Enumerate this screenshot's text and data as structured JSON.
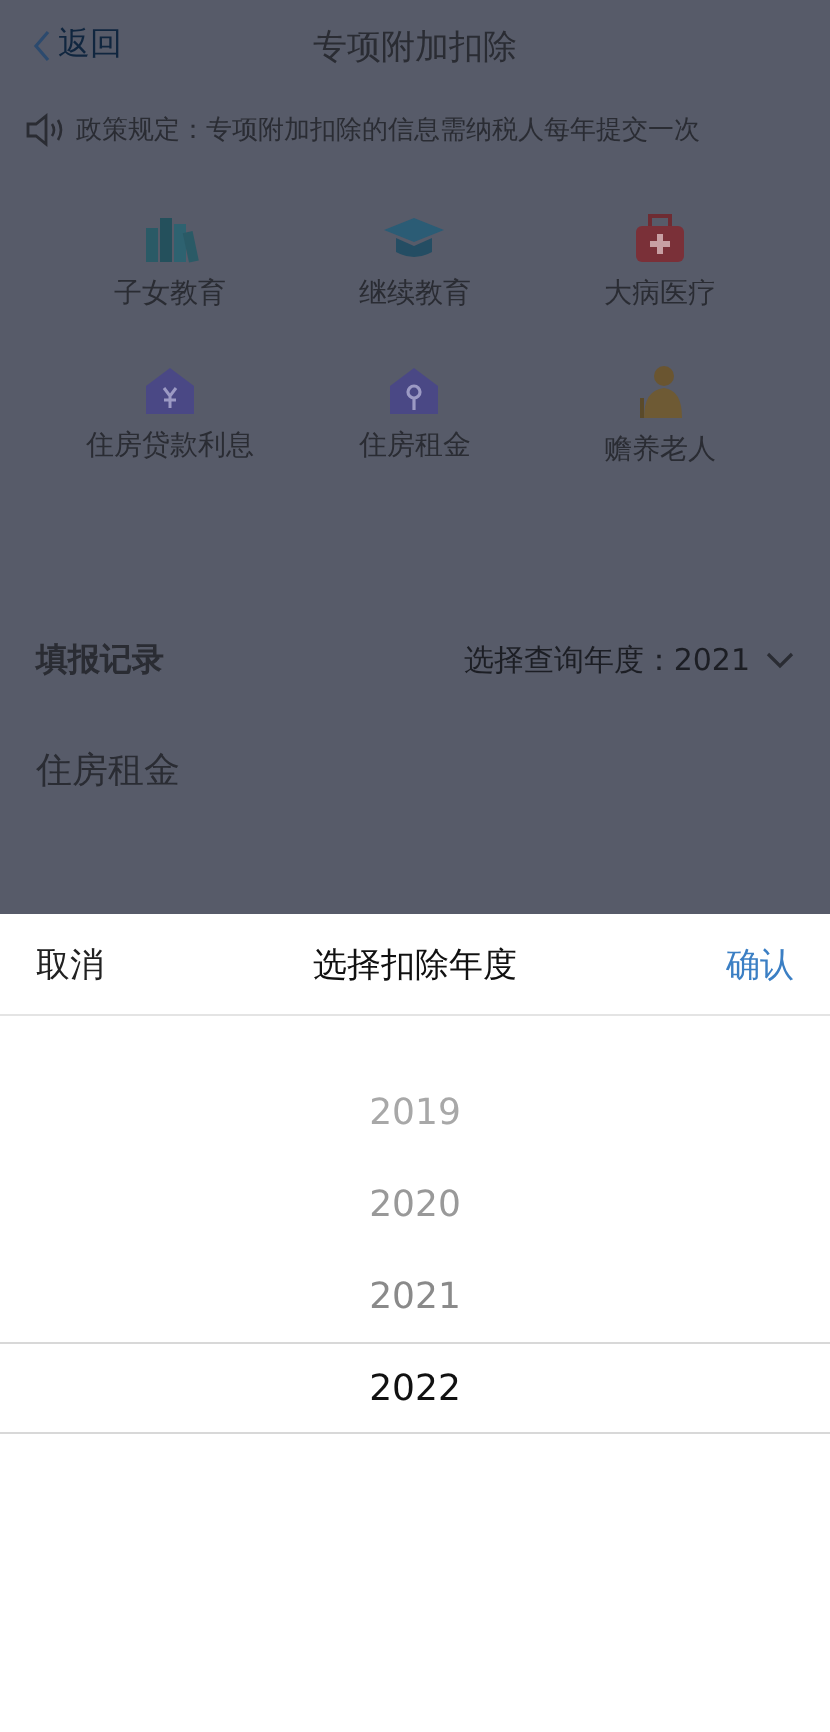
{
  "nav": {
    "back": "返回",
    "title": "专项附加扣除"
  },
  "notice": "政策规定：专项附加扣除的信息需纳税人每年提交一次",
  "categories": [
    {
      "kind": "books",
      "label": "子女教育"
    },
    {
      "kind": "cap",
      "label": "继续教育"
    },
    {
      "kind": "medkit",
      "label": "大病医疗"
    },
    {
      "kind": "house-yen",
      "label": "住房贷款利息"
    },
    {
      "kind": "house-key",
      "label": "住房租金"
    },
    {
      "kind": "elder",
      "label": "赡养老人"
    }
  ],
  "records": {
    "title": "填报记录",
    "year_filter": "选择查询年度：2021",
    "first_item": "住房租金"
  },
  "sheet": {
    "cancel": "取消",
    "title": "选择扣除年度",
    "confirm": "确认",
    "years": [
      {
        "label": "2019",
        "selected": false
      },
      {
        "label": "2020",
        "selected": false
      },
      {
        "label": "2021",
        "selected": false
      },
      {
        "label": "2022",
        "selected": true
      }
    ]
  }
}
